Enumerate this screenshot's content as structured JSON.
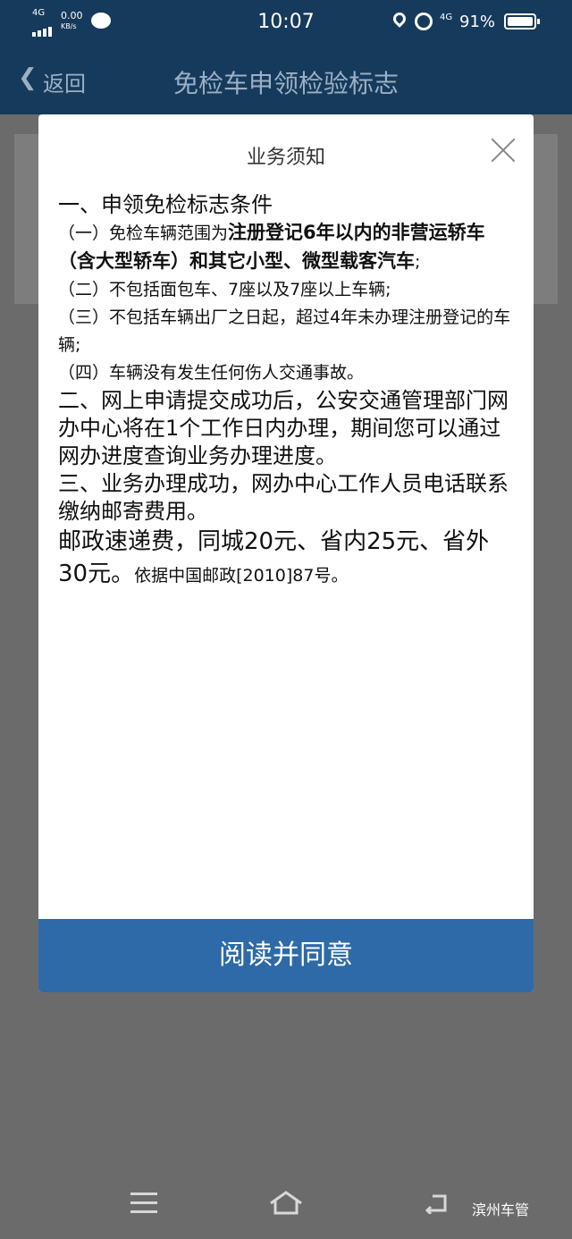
{
  "status_bar": {
    "signal": "4G",
    "net_speed": "0.00",
    "net_unit": "KB/s",
    "time": "10:07",
    "network2": "4G",
    "battery": "91%"
  },
  "app_bar": {
    "back_label": "返回",
    "title": "免检车申领检验标志"
  },
  "dialog": {
    "title": "业务须知",
    "heading1": "一、申领免检标志条件",
    "item1_prefix": "（一）免检车辆范围为",
    "item1_bold": "注册登记6年以内的非营运轿车（含大型轿车）和其它小型、微型载客汽车",
    "item1_suffix": ";",
    "item2": "（二）不包括面包车、7座以及7座以上车辆;",
    "item3": "（三）不包括车辆出厂之日起，超过4年未办理注册登记的车辆;",
    "item4": "（四）车辆没有发生任何伤人交通事故。",
    "section2": "二、网上申请提交成功后，公安交通管理部门网办中心将在1个工作日内办理，期间您可以通过网办进度查询业务办理进度。",
    "section3": "三、业务办理成功，网办中心工作人员电话联系缴纳邮寄费用。",
    "fee_main": "邮政速递费，同城20元、省内25元、省外30元。",
    "fee_ref": "依据中国邮政[2010]87号。",
    "agree_button": "阅读并同意"
  },
  "watermark": "滨州车管",
  "colors": {
    "header_bg": "#163a5c",
    "button_bg": "#2e6aa8",
    "overlay_bg": "#6b6b6b"
  }
}
